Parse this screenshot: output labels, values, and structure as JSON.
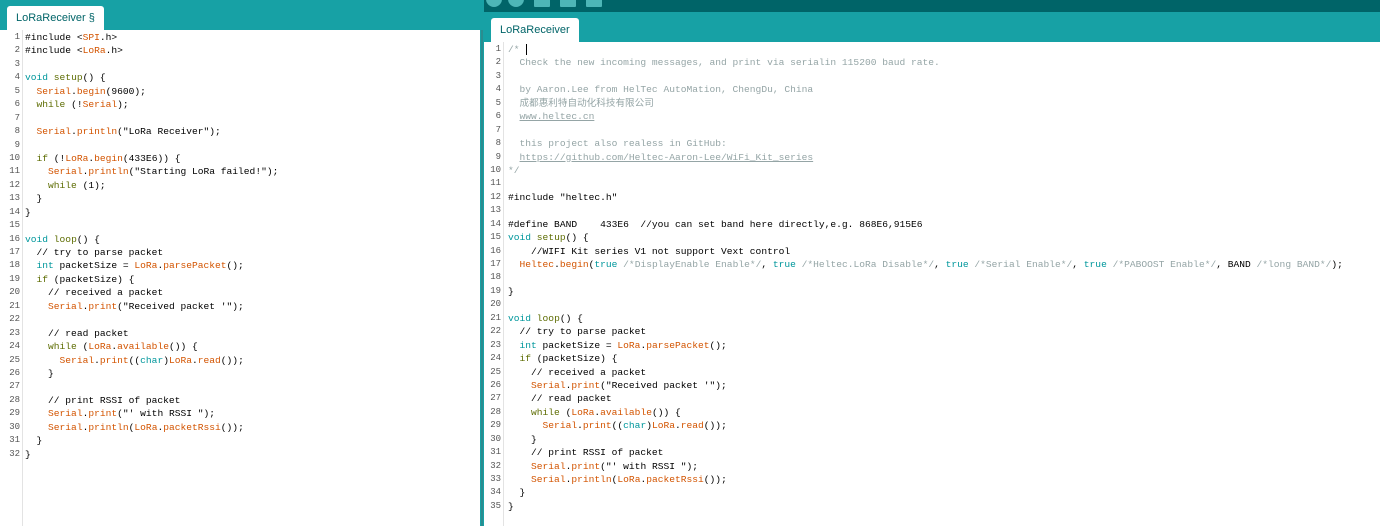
{
  "left": {
    "tab_label": "LoRaReceiver §",
    "lines": [
      [
        {
          "t": "#include <",
          "c": ""
        },
        {
          "t": "SPI",
          "c": "fn"
        },
        {
          "t": ".h>",
          "c": ""
        }
      ],
      [
        {
          "t": "#include <",
          "c": ""
        },
        {
          "t": "LoRa",
          "c": "fn"
        },
        {
          "t": ".h>",
          "c": ""
        }
      ],
      [],
      [
        {
          "t": "void",
          "c": "ty"
        },
        {
          "t": " ",
          "c": ""
        },
        {
          "t": "setup",
          "c": "kw"
        },
        {
          "t": "() {",
          "c": ""
        }
      ],
      [
        {
          "t": "  ",
          "c": ""
        },
        {
          "t": "Serial",
          "c": "fn"
        },
        {
          "t": ".",
          "c": ""
        },
        {
          "t": "begin",
          "c": "fn"
        },
        {
          "t": "(9600);",
          "c": ""
        }
      ],
      [
        {
          "t": "  ",
          "c": ""
        },
        {
          "t": "while",
          "c": "kw"
        },
        {
          "t": " (!",
          "c": ""
        },
        {
          "t": "Serial",
          "c": "fn"
        },
        {
          "t": ");",
          "c": ""
        }
      ],
      [],
      [
        {
          "t": "  ",
          "c": ""
        },
        {
          "t": "Serial",
          "c": "fn"
        },
        {
          "t": ".",
          "c": ""
        },
        {
          "t": "println",
          "c": "fn"
        },
        {
          "t": "(\"LoRa Receiver\");",
          "c": ""
        }
      ],
      [],
      [
        {
          "t": "  ",
          "c": ""
        },
        {
          "t": "if",
          "c": "kw"
        },
        {
          "t": " (!",
          "c": ""
        },
        {
          "t": "LoRa",
          "c": "fn"
        },
        {
          "t": ".",
          "c": ""
        },
        {
          "t": "begin",
          "c": "fn"
        },
        {
          "t": "(433E6)) {",
          "c": ""
        }
      ],
      [
        {
          "t": "    ",
          "c": ""
        },
        {
          "t": "Serial",
          "c": "fn"
        },
        {
          "t": ".",
          "c": ""
        },
        {
          "t": "println",
          "c": "fn"
        },
        {
          "t": "(\"Starting LoRa failed!\");",
          "c": ""
        }
      ],
      [
        {
          "t": "    ",
          "c": ""
        },
        {
          "t": "while",
          "c": "kw"
        },
        {
          "t": " (1);",
          "c": ""
        }
      ],
      [
        {
          "t": "  }",
          "c": ""
        }
      ],
      [
        {
          "t": "}",
          "c": ""
        }
      ],
      [],
      [
        {
          "t": "void",
          "c": "ty"
        },
        {
          "t": " ",
          "c": ""
        },
        {
          "t": "loop",
          "c": "kw"
        },
        {
          "t": "() {",
          "c": ""
        }
      ],
      [
        {
          "t": "  // try to parse packet",
          "c": ""
        }
      ],
      [
        {
          "t": "  ",
          "c": ""
        },
        {
          "t": "int",
          "c": "ty"
        },
        {
          "t": " packetSize = ",
          "c": ""
        },
        {
          "t": "LoRa",
          "c": "fn"
        },
        {
          "t": ".",
          "c": ""
        },
        {
          "t": "parsePacket",
          "c": "fn"
        },
        {
          "t": "();",
          "c": ""
        }
      ],
      [
        {
          "t": "  ",
          "c": ""
        },
        {
          "t": "if",
          "c": "kw"
        },
        {
          "t": " (packetSize) {",
          "c": ""
        }
      ],
      [
        {
          "t": "    // received a packet",
          "c": ""
        }
      ],
      [
        {
          "t": "    ",
          "c": ""
        },
        {
          "t": "Serial",
          "c": "fn"
        },
        {
          "t": ".",
          "c": ""
        },
        {
          "t": "print",
          "c": "fn"
        },
        {
          "t": "(\"Received packet '\");",
          "c": ""
        }
      ],
      [],
      [
        {
          "t": "    // read packet",
          "c": ""
        }
      ],
      [
        {
          "t": "    ",
          "c": ""
        },
        {
          "t": "while",
          "c": "kw"
        },
        {
          "t": " (",
          "c": ""
        },
        {
          "t": "LoRa",
          "c": "fn"
        },
        {
          "t": ".",
          "c": ""
        },
        {
          "t": "available",
          "c": "fn"
        },
        {
          "t": "()) {",
          "c": ""
        }
      ],
      [
        {
          "t": "      ",
          "c": ""
        },
        {
          "t": "Serial",
          "c": "fn"
        },
        {
          "t": ".",
          "c": ""
        },
        {
          "t": "print",
          "c": "fn"
        },
        {
          "t": "((",
          "c": ""
        },
        {
          "t": "char",
          "c": "ty"
        },
        {
          "t": ")",
          "c": ""
        },
        {
          "t": "LoRa",
          "c": "fn"
        },
        {
          "t": ".",
          "c": ""
        },
        {
          "t": "read",
          "c": "fn"
        },
        {
          "t": "());",
          "c": ""
        }
      ],
      [
        {
          "t": "    }",
          "c": ""
        }
      ],
      [],
      [
        {
          "t": "    // print RSSI of packet",
          "c": ""
        }
      ],
      [
        {
          "t": "    ",
          "c": ""
        },
        {
          "t": "Serial",
          "c": "fn"
        },
        {
          "t": ".",
          "c": ""
        },
        {
          "t": "print",
          "c": "fn"
        },
        {
          "t": "(\"' with RSSI \");",
          "c": ""
        }
      ],
      [
        {
          "t": "    ",
          "c": ""
        },
        {
          "t": "Serial",
          "c": "fn"
        },
        {
          "t": ".",
          "c": ""
        },
        {
          "t": "println",
          "c": "fn"
        },
        {
          "t": "(",
          "c": ""
        },
        {
          "t": "LoRa",
          "c": "fn"
        },
        {
          "t": ".",
          "c": ""
        },
        {
          "t": "packetRssi",
          "c": "fn"
        },
        {
          "t": "());",
          "c": ""
        }
      ],
      [
        {
          "t": "  }",
          "c": ""
        }
      ],
      [
        {
          "t": "}",
          "c": ""
        }
      ]
    ]
  },
  "right": {
    "tab_label": "LoRaReceiver",
    "lines": [
      [
        {
          "t": "/* ",
          "c": "cm"
        }
      ],
      [
        {
          "t": "  Check the new incoming messages, and print via serialin 115200 baud rate.",
          "c": "cm"
        }
      ],
      [],
      [
        {
          "t": "  by Aaron.Lee from HelTec AutoMation, ChengDu, China",
          "c": "cm"
        }
      ],
      [
        {
          "t": "  成都惠利特自动化科技有限公司",
          "c": "cm"
        }
      ],
      [
        {
          "t": "  ",
          "c": "cm"
        },
        {
          "t": "www.heltec.cn",
          "c": "cmu"
        }
      ],
      [],
      [
        {
          "t": "  this project also realess in GitHub:",
          "c": "cm"
        }
      ],
      [
        {
          "t": "  ",
          "c": "cm"
        },
        {
          "t": "https://github.com/Heltec-Aaron-Lee/WiFi_Kit_series",
          "c": "cmu"
        }
      ],
      [
        {
          "t": "*/",
          "c": "cm"
        }
      ],
      [],
      [
        {
          "t": "#include \"heltec.h\"",
          "c": ""
        }
      ],
      [],
      [
        {
          "t": "#define BAND    433E6  //you can set band here directly,e.g. 868E6,915E6",
          "c": ""
        }
      ],
      [
        {
          "t": "void",
          "c": "ty"
        },
        {
          "t": " ",
          "c": ""
        },
        {
          "t": "setup",
          "c": "kw"
        },
        {
          "t": "() {",
          "c": ""
        }
      ],
      [
        {
          "t": "    //WIFI Kit series V1 not support Vext control",
          "c": ""
        }
      ],
      [
        {
          "t": "  ",
          "c": ""
        },
        {
          "t": "Heltec",
          "c": "fn"
        },
        {
          "t": ".",
          "c": ""
        },
        {
          "t": "begin",
          "c": "fn"
        },
        {
          "t": "(",
          "c": ""
        },
        {
          "t": "true",
          "c": "lit"
        },
        {
          "t": " /*DisplayEnable Enable*/",
          "c": "cm"
        },
        {
          "t": ", ",
          "c": ""
        },
        {
          "t": "true",
          "c": "lit"
        },
        {
          "t": " /*Heltec.LoRa Disable*/",
          "c": "cm"
        },
        {
          "t": ", ",
          "c": ""
        },
        {
          "t": "true",
          "c": "lit"
        },
        {
          "t": " /*Serial Enable*/",
          "c": "cm"
        },
        {
          "t": ", ",
          "c": ""
        },
        {
          "t": "true",
          "c": "lit"
        },
        {
          "t": " /*PABOOST Enable*/",
          "c": "cm"
        },
        {
          "t": ", BAND ",
          "c": ""
        },
        {
          "t": "/*long BAND*/",
          "c": "cm"
        },
        {
          "t": ");",
          "c": ""
        }
      ],
      [],
      [
        {
          "t": "}",
          "c": ""
        }
      ],
      [],
      [
        {
          "t": "void",
          "c": "ty"
        },
        {
          "t": " ",
          "c": ""
        },
        {
          "t": "loop",
          "c": "kw"
        },
        {
          "t": "() {",
          "c": ""
        }
      ],
      [
        {
          "t": "  // try to parse packet",
          "c": ""
        }
      ],
      [
        {
          "t": "  ",
          "c": ""
        },
        {
          "t": "int",
          "c": "ty"
        },
        {
          "t": " packetSize = ",
          "c": ""
        },
        {
          "t": "LoRa",
          "c": "fn"
        },
        {
          "t": ".",
          "c": ""
        },
        {
          "t": "parsePacket",
          "c": "fn"
        },
        {
          "t": "();",
          "c": ""
        }
      ],
      [
        {
          "t": "  ",
          "c": ""
        },
        {
          "t": "if",
          "c": "kw"
        },
        {
          "t": " (packetSize) {",
          "c": ""
        }
      ],
      [
        {
          "t": "    // received a packet",
          "c": ""
        }
      ],
      [
        {
          "t": "    ",
          "c": ""
        },
        {
          "t": "Serial",
          "c": "fn"
        },
        {
          "t": ".",
          "c": ""
        },
        {
          "t": "print",
          "c": "fn"
        },
        {
          "t": "(\"Received packet '\");",
          "c": ""
        }
      ],
      [
        {
          "t": "    // read packet",
          "c": ""
        }
      ],
      [
        {
          "t": "    ",
          "c": ""
        },
        {
          "t": "while",
          "c": "kw"
        },
        {
          "t": " (",
          "c": ""
        },
        {
          "t": "LoRa",
          "c": "fn"
        },
        {
          "t": ".",
          "c": ""
        },
        {
          "t": "available",
          "c": "fn"
        },
        {
          "t": "()) {",
          "c": ""
        }
      ],
      [
        {
          "t": "      ",
          "c": ""
        },
        {
          "t": "Serial",
          "c": "fn"
        },
        {
          "t": ".",
          "c": ""
        },
        {
          "t": "print",
          "c": "fn"
        },
        {
          "t": "((",
          "c": ""
        },
        {
          "t": "char",
          "c": "ty"
        },
        {
          "t": ")",
          "c": ""
        },
        {
          "t": "LoRa",
          "c": "fn"
        },
        {
          "t": ".",
          "c": ""
        },
        {
          "t": "read",
          "c": "fn"
        },
        {
          "t": "());",
          "c": ""
        }
      ],
      [
        {
          "t": "    }",
          "c": ""
        }
      ],
      [
        {
          "t": "    // print RSSI of packet",
          "c": ""
        }
      ],
      [
        {
          "t": "    ",
          "c": ""
        },
        {
          "t": "Serial",
          "c": "fn"
        },
        {
          "t": ".",
          "c": ""
        },
        {
          "t": "print",
          "c": "fn"
        },
        {
          "t": "(\"' with RSSI \");",
          "c": ""
        }
      ],
      [
        {
          "t": "    ",
          "c": ""
        },
        {
          "t": "Serial",
          "c": "fn"
        },
        {
          "t": ".",
          "c": ""
        },
        {
          "t": "println",
          "c": "fn"
        },
        {
          "t": "(",
          "c": ""
        },
        {
          "t": "LoRa",
          "c": "fn"
        },
        {
          "t": ".",
          "c": ""
        },
        {
          "t": "packetRssi",
          "c": "fn"
        },
        {
          "t": "());",
          "c": ""
        }
      ],
      [
        {
          "t": "  }",
          "c": ""
        }
      ],
      [
        {
          "t": "}",
          "c": ""
        }
      ]
    ]
  },
  "colors": {
    "tabbar": "#17a1a5",
    "toolbar": "#006468",
    "tab_text": "#006468",
    "function": "#d35400",
    "keyword": "#5e6d03",
    "type": "#00979c",
    "comment": "#95a5a6"
  },
  "icons": [
    "verify-icon",
    "upload-icon",
    "new-sketch-icon",
    "open-icon",
    "save-icon"
  ]
}
